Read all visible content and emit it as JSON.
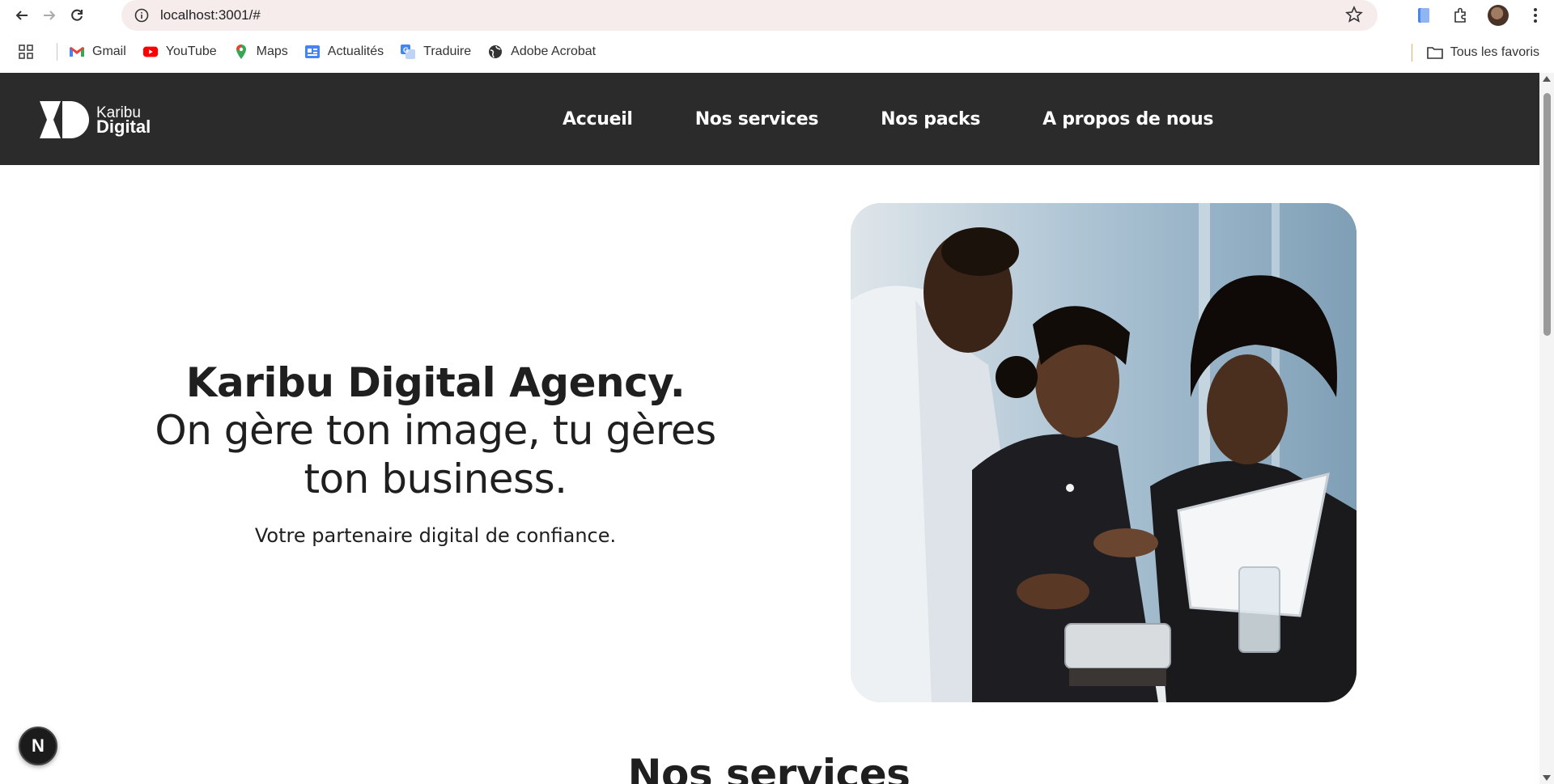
{
  "browser": {
    "url": "localhost:3001/#",
    "bookmarks": [
      {
        "label": "Gmail",
        "icon": "gmail-icon"
      },
      {
        "label": "YouTube",
        "icon": "youtube-icon"
      },
      {
        "label": "Maps",
        "icon": "maps-icon"
      },
      {
        "label": "Actualités",
        "icon": "news-icon"
      },
      {
        "label": "Traduire",
        "icon": "translate-icon"
      },
      {
        "label": "Adobe Acrobat",
        "icon": "globe-icon"
      }
    ],
    "all_bookmarks": "Tous les favoris"
  },
  "site": {
    "logo": {
      "line1": "Karibu",
      "line2": "Digital"
    },
    "nav": [
      "Accueil",
      "Nos services",
      "Nos packs",
      "A propos de nous"
    ],
    "hero": {
      "title": "Karibu Digital Agency.",
      "tagline": "On gère ton image, tu gères ton business.",
      "subtitle": "Votre partenaire digital de confiance.",
      "image": "three-colleagues-reviewing-tablet-photo"
    },
    "services_heading": "Nos services",
    "dev_badge": "N",
    "colors": {
      "header_bg": "#2b2b2b",
      "text": "#1f1f1f"
    }
  }
}
